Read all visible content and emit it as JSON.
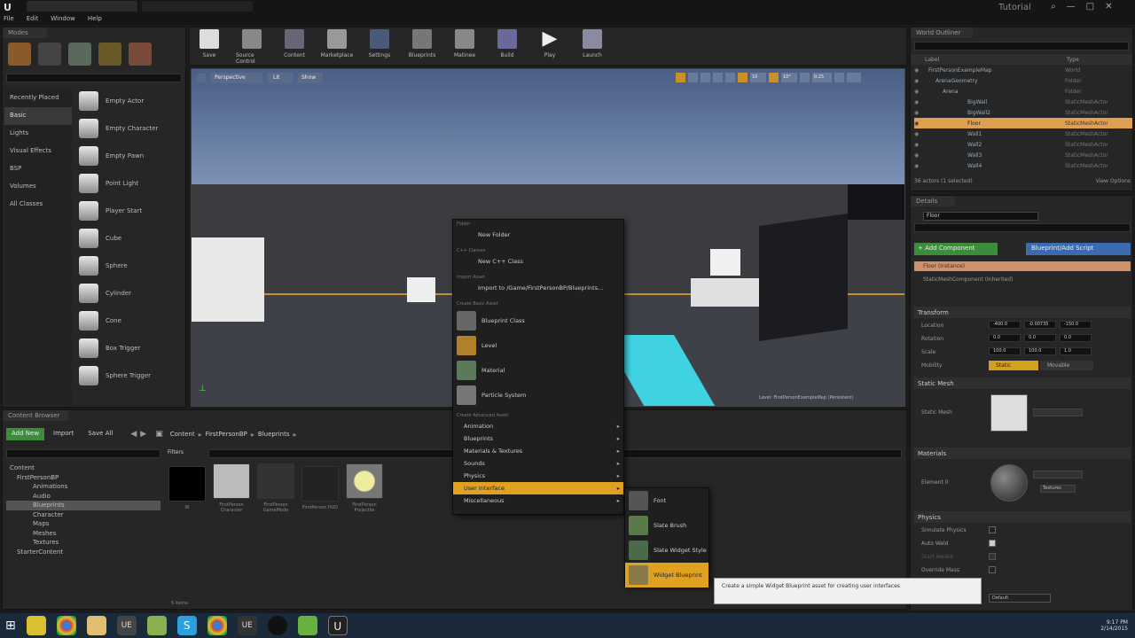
{
  "menubar": {
    "items": [
      "File",
      "Edit",
      "Window",
      "Help"
    ],
    "title": "Tutorial"
  },
  "modes": {
    "tab": "Modes"
  },
  "place": {
    "categories": [
      "Recently Placed",
      "Basic",
      "Lights",
      "Visual Effects",
      "BSP",
      "Volumes",
      "All Classes"
    ],
    "items": [
      "Empty Actor",
      "Empty Character",
      "Empty Pawn",
      "Point Light",
      "Player Start",
      "Cube",
      "Sphere",
      "Cylinder",
      "Cone",
      "Box Trigger",
      "Sphere Trigger"
    ]
  },
  "toolbar": {
    "buttons": [
      "Save",
      "Source Control",
      "Content",
      "Marketplace",
      "Settings",
      "Blueprints",
      "Matinee",
      "Build",
      "Play",
      "Launch"
    ]
  },
  "viewport": {
    "perspective": "Perspective",
    "lit": "Lit",
    "show": "Show",
    "snap1": "10",
    "snap2": "10°",
    "snap3": "0.25",
    "level_label": "Level: FirstPersonExampleMap (Persistent)"
  },
  "context_menu": {
    "folder_header": "Folder",
    "new_folder": "New Folder",
    "cpp_header": "C++ Classes",
    "new_cpp": "New C++ Class",
    "import_header": "Import Asset",
    "import_to": "Import to /Game/FirstPersonBP/Blueprints...",
    "basic_header": "Create Basic Asset",
    "basic": [
      "Blueprint Class",
      "Level",
      "Material",
      "Particle System"
    ],
    "adv_header": "Create Advanced Asset",
    "advanced": [
      "Animation",
      "Blueprints",
      "Materials & Textures",
      "Sounds",
      "Physics",
      "User Interface",
      "Miscellaneous"
    ]
  },
  "submenu": [
    "Font",
    "Slate Brush",
    "Slate Widget Style",
    "Widget Blueprint"
  ],
  "tooltip": "Create a simple Widget Blueprint asset for creating user interfaces",
  "outliner": {
    "tab": "World Outliner",
    "col_label": "Label",
    "col_type": "Type",
    "rows": [
      {
        "label": "FirstPersonExampleMap",
        "type": "World"
      },
      {
        "label": "ArenaGeometry",
        "type": "Folder"
      },
      {
        "label": "Arena",
        "type": "Folder"
      },
      {
        "label": "BigWall",
        "type": "StaticMeshActor"
      },
      {
        "label": "BigWall2",
        "type": "StaticMeshActor"
      },
      {
        "label": "Floor",
        "type": "StaticMeshActor"
      },
      {
        "label": "Wall1",
        "type": "StaticMeshActor"
      },
      {
        "label": "Wall2",
        "type": "StaticMeshActor"
      },
      {
        "label": "Wall3",
        "type": "StaticMeshActor"
      },
      {
        "label": "Wall4",
        "type": "StaticMeshActor"
      }
    ],
    "footer": "36 actors (1 selected)",
    "view_options": "View Options"
  },
  "details": {
    "tab": "Details",
    "name": "Floor",
    "add_component": "+ Add Component",
    "blueprint_btn": "Blueprint/Add Script",
    "root": "Floor (Instance)",
    "component": "StaticMeshComponent (Inherited)",
    "transform": "Transform",
    "location_label": "Location",
    "rotation_label": "Rotation",
    "scale_label": "Scale",
    "mobility_label": "Mobility",
    "location": [
      "-400.0",
      "-0.00735",
      "-150.0"
    ],
    "rotation": [
      "0.0",
      "0.0",
      "0.0"
    ],
    "scale": [
      "100.0",
      "100.0",
      "1.0"
    ],
    "static": "Static",
    "movable": "Movable",
    "static_mesh": "Static Mesh",
    "static_mesh_label": "Static Mesh",
    "materials": "Materials",
    "element": "Element 0",
    "textures": "Textures",
    "physics": "Physics",
    "physics_rows": [
      "Simulate Physics",
      "Auto Weld",
      "Start Awake",
      "Override Mass"
    ],
    "default": "Default"
  },
  "content_browser": {
    "tab": "Content Browser",
    "add_new": "Add New",
    "import": "Import",
    "save_all": "Save All",
    "path": [
      "Content",
      "FirstPersonBP",
      "Blueprints"
    ],
    "filters": "Filters",
    "tree": [
      "Content",
      "FirstPersonBP",
      "Animations",
      "Audio",
      "Blueprints",
      "Character",
      "Maps",
      "Meshes",
      "Textures",
      "StarterContent"
    ],
    "assets": [
      "W",
      "FirstPerson Character",
      "FirstPerson GameMode",
      "FirstPerson HUD",
      "FirstPerson Projectile"
    ],
    "items_count": "5 items"
  },
  "taskbar": {
    "time": "9:17 PM",
    "date": "2/14/2015"
  }
}
